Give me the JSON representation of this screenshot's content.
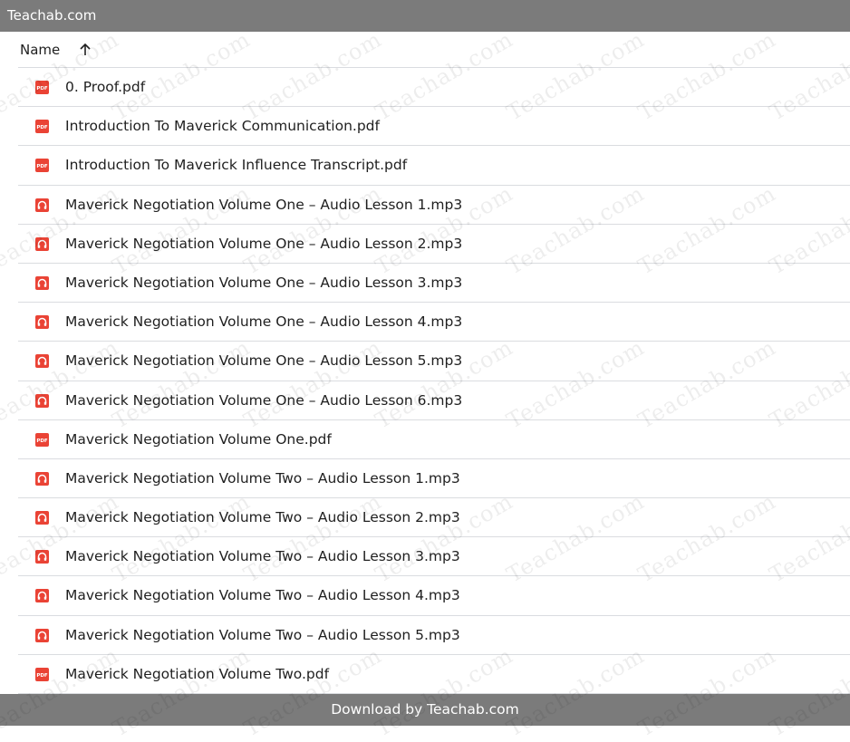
{
  "topbar": {
    "title": "Teachab.com"
  },
  "header": {
    "name_label": "Name",
    "sort_icon": "arrow-up-icon"
  },
  "files": [
    {
      "name": "0. Proof.pdf",
      "type": "pdf"
    },
    {
      "name": "Introduction To Maverick Communication.pdf",
      "type": "pdf"
    },
    {
      "name": "Introduction To Maverick Influence Transcript.pdf",
      "type": "pdf"
    },
    {
      "name": "Maverick Negotiation Volume One – Audio Lesson 1.mp3",
      "type": "audio"
    },
    {
      "name": "Maverick Negotiation Volume One – Audio Lesson 2.mp3",
      "type": "audio"
    },
    {
      "name": "Maverick Negotiation Volume One – Audio Lesson 3.mp3",
      "type": "audio"
    },
    {
      "name": "Maverick Negotiation Volume One – Audio Lesson 4.mp3",
      "type": "audio"
    },
    {
      "name": "Maverick Negotiation Volume One – Audio Lesson 5.mp3",
      "type": "audio"
    },
    {
      "name": "Maverick Negotiation Volume One – Audio Lesson 6.mp3",
      "type": "audio"
    },
    {
      "name": "Maverick Negotiation Volume One.pdf",
      "type": "pdf"
    },
    {
      "name": "Maverick Negotiation Volume Two – Audio Lesson 1.mp3",
      "type": "audio"
    },
    {
      "name": "Maverick Negotiation Volume Two – Audio Lesson 2.mp3",
      "type": "audio"
    },
    {
      "name": "Maverick Negotiation Volume Two – Audio Lesson 3.mp3",
      "type": "audio"
    },
    {
      "name": "Maverick Negotiation Volume Two – Audio Lesson 4.mp3",
      "type": "audio"
    },
    {
      "name": "Maverick Negotiation Volume Two – Audio Lesson 5.mp3",
      "type": "audio"
    },
    {
      "name": "Maverick Negotiation Volume Two.pdf",
      "type": "pdf"
    }
  ],
  "icon_labels": {
    "pdf": "PDF"
  },
  "footer": {
    "text": "Download by Teachab.com"
  },
  "watermark": {
    "text": "Teachab.com"
  },
  "colors": {
    "bar": "#7b7b7b",
    "file_icon_red": "#ea4335",
    "divider": "#dadce0"
  }
}
